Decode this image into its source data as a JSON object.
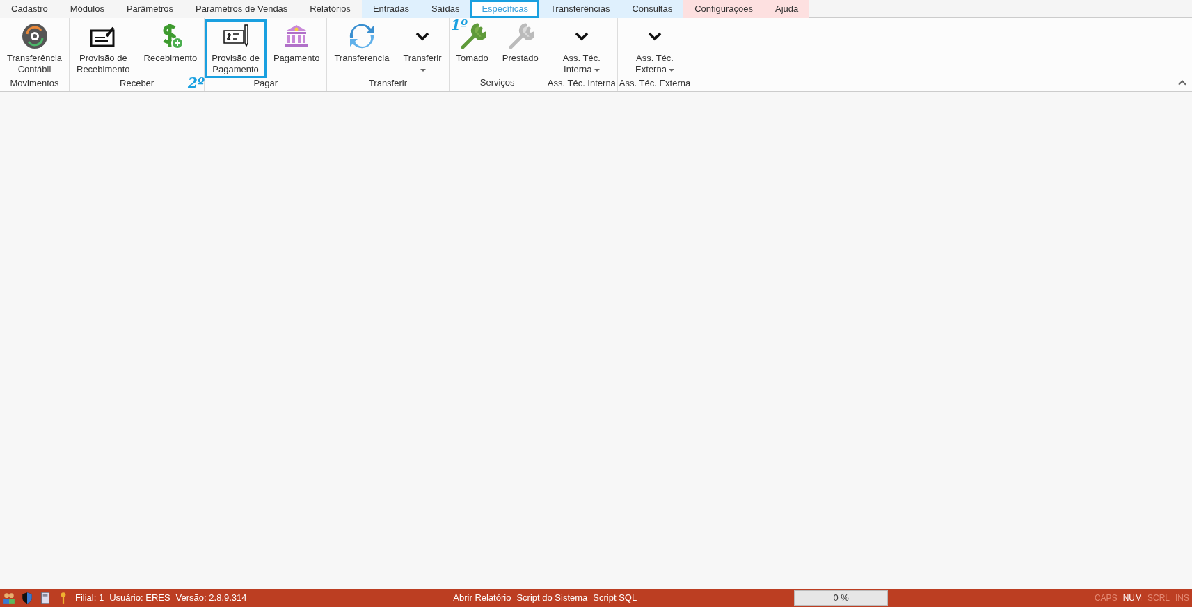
{
  "menu_tabs": [
    {
      "label": "Cadastro",
      "selected": false,
      "color": "#f5f5f5",
      "highlighted": false
    },
    {
      "label": "Módulos",
      "selected": false,
      "color": "#f5f5f5",
      "highlighted": false
    },
    {
      "label": "Parâmetros",
      "selected": false,
      "color": "#f5f5f5",
      "highlighted": false
    },
    {
      "label": "Parametros de Vendas",
      "selected": false,
      "color": "#f5f5f5",
      "highlighted": false
    },
    {
      "label": "Relatórios",
      "selected": false,
      "color": "#f5f5f5",
      "highlighted": false
    },
    {
      "label": "Entradas",
      "selected": false,
      "color": "#dff0fd",
      "highlighted": false
    },
    {
      "label": "Saídas",
      "selected": false,
      "color": "#dff0fd",
      "highlighted": false
    },
    {
      "label": "Específicas",
      "selected": true,
      "highlighted": true,
      "annotation": "1º"
    },
    {
      "label": "Transferências",
      "selected": false,
      "color": "#dff0fd",
      "highlighted": false
    },
    {
      "label": "Consultas",
      "selected": false,
      "color": "#dff0fd",
      "highlighted": false
    },
    {
      "label": "Configurações",
      "selected": false,
      "color": "#fde0e0",
      "highlighted": false
    },
    {
      "label": "Ajuda",
      "selected": false,
      "color": "#fde0e0",
      "highlighted": false
    }
  ],
  "ribbon_groups": [
    {
      "title": "Movimentos",
      "buttons": [
        {
          "lines": [
            "Transferência",
            "Contábil"
          ],
          "dropdown": false,
          "highlighted": false
        }
      ]
    },
    {
      "title": "Receber",
      "buttons": [
        {
          "lines": [
            "Provisão de",
            "Recebimento"
          ],
          "dropdown": false,
          "highlighted": false
        },
        {
          "lines": [
            "Recebimento"
          ],
          "dropdown": false,
          "highlighted": false
        }
      ]
    },
    {
      "title": "Pagar",
      "buttons": [
        {
          "lines": [
            "Provisão de",
            "Pagamento"
          ],
          "dropdown": false,
          "highlighted": true,
          "annotation": "2º"
        },
        {
          "lines": [
            "Pagamento"
          ],
          "dropdown": false,
          "highlighted": false
        }
      ]
    },
    {
      "title": "Transferir",
      "buttons": [
        {
          "lines": [
            "Transferencia"
          ],
          "dropdown": false,
          "highlighted": false
        },
        {
          "lines": [
            "Transferir"
          ],
          "dropdown": true,
          "highlighted": false
        }
      ]
    },
    {
      "title": "Serviços",
      "buttons": [
        {
          "lines": [
            "Tomado"
          ],
          "dropdown": false,
          "highlighted": false
        },
        {
          "lines": [
            "Prestado"
          ],
          "dropdown": false,
          "highlighted": false
        }
      ]
    },
    {
      "title": "Ass. Téc. Interna",
      "buttons": [
        {
          "lines": [
            "Ass. Téc.",
            "Interna"
          ],
          "dropdown": true,
          "highlighted": false
        }
      ]
    },
    {
      "title": "Ass. Téc. Externa",
      "buttons": [
        {
          "lines": [
            "Ass. Téc.",
            "Externa"
          ],
          "dropdown": true,
          "highlighted": false
        }
      ]
    }
  ],
  "status_bar": {
    "info": [
      "Filial: 1",
      "Usuário: ERES",
      "Versão: 2.8.9.314"
    ],
    "links": [
      "Abrir Relatório",
      "Script do Sistema",
      "Script SQL"
    ],
    "progress": {
      "text": "0 %",
      "level": 0
    },
    "indicators": [
      {
        "label": "CAPS",
        "on": false
      },
      {
        "label": "NUM",
        "on": true
      },
      {
        "label": "SCRL",
        "on": false
      },
      {
        "label": "INS",
        "on": false
      }
    ]
  }
}
